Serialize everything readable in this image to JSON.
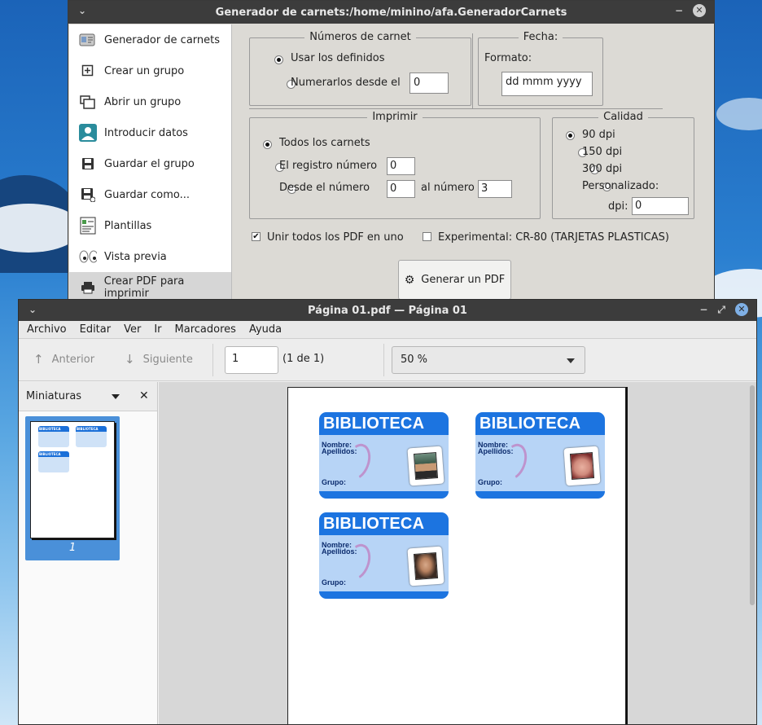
{
  "win1": {
    "title": "Generador de carnets:/home/minino/afa.GeneradorCarnets",
    "minimize": "⌄",
    "maximize": "−",
    "close": "✕",
    "sidebar": [
      {
        "label": "Generador de carnets",
        "icon": "id-card-icon"
      },
      {
        "label": "Crear un grupo",
        "icon": "new-group-icon"
      },
      {
        "label": "Abrir un grupo",
        "icon": "open-group-icon"
      },
      {
        "label": "Introducir datos",
        "icon": "user-data-icon"
      },
      {
        "label": "Guardar el grupo",
        "icon": "save-icon"
      },
      {
        "label": "Guardar como...",
        "icon": "save-as-icon"
      },
      {
        "label": "Plantillas",
        "icon": "templates-icon"
      },
      {
        "label": "Vista previa",
        "icon": "eyes-icon"
      },
      {
        "label": "Crear PDF para imprimir",
        "icon": "printer-icon"
      }
    ],
    "numeros": {
      "legend": "Números de carnet",
      "opt1": "Usar los definidos",
      "opt2": "Numerarlos desde el",
      "start": "0"
    },
    "fecha": {
      "legend": "Fecha:",
      "formato_label": "Formato:",
      "formato": "dd mmm yyyy"
    },
    "imprimir": {
      "legend": "Imprimir",
      "opt1": "Todos los carnets",
      "opt2": "El registro número",
      "registro": "0",
      "opt3": "Desde el número",
      "desde": "0",
      "al_label": "al número",
      "hasta": "3"
    },
    "calidad": {
      "legend": "Calidad",
      "opts": [
        "90 dpi",
        "150 dpi",
        "300 dpi",
        "Personalizado:"
      ],
      "dpi_label": "dpi:",
      "dpi": "0"
    },
    "unir": "Unir todos los PDF en uno",
    "experimental": "Experimental: CR-80 (TARJETAS PLASTICAS)",
    "generar": "Generar un PDF"
  },
  "win2": {
    "title": "Página 01.pdf — Página 01",
    "menu": [
      "Archivo",
      "Editar",
      "Ver",
      "Ir",
      "Marcadores",
      "Ayuda"
    ],
    "anterior": "Anterior",
    "siguiente": "Siguiente",
    "page": "1",
    "page_count": "(1 de 1)",
    "zoom": "50 %",
    "thumb_title": "Miniaturas",
    "thumb_page_num": "1",
    "card_title": "BIBLIOTECA",
    "labels": {
      "nombre": "Nombre:",
      "apellidos": "Apellidos:",
      "grupo": "Grupo:"
    },
    "colors": {
      "card_blue": "#1c74e0",
      "card_bg": "#b7d4f6",
      "selection": "#4a90d9"
    }
  }
}
